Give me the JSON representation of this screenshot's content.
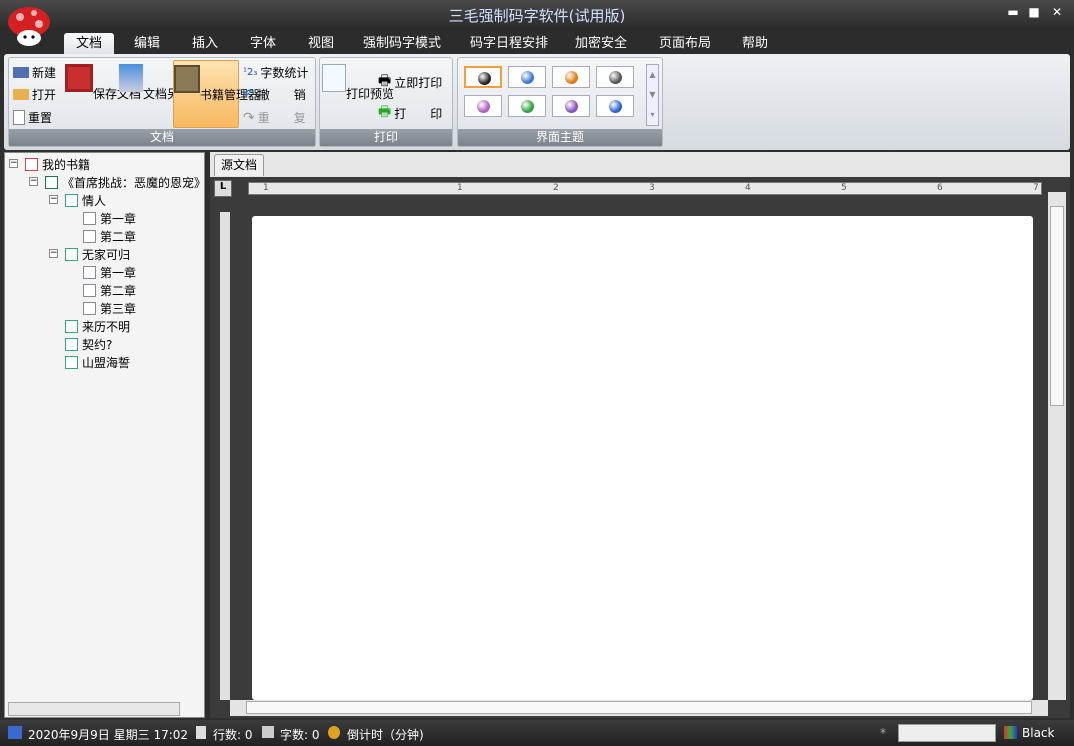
{
  "window": {
    "title": "三毛强制码字软件(试用版)",
    "minimize": "▬",
    "maximize": "■",
    "close": "✕"
  },
  "tabs": [
    "文档",
    "编辑",
    "插入",
    "字体",
    "视图",
    "强制码字模式",
    "码字日程安排",
    "加密安全",
    "页面布局",
    "帮助"
  ],
  "ribbon": {
    "doc_group": {
      "label": "文档",
      "new": "新建",
      "open": "打开",
      "reset": "重置",
      "save": "保存文档",
      "save_as": "文档另存",
      "book_manager": "书籍管理器",
      "word_count": "字数统计",
      "undo": "撤　　销",
      "redo": "重　　复"
    },
    "print_group": {
      "label": "打印",
      "preview": "打印预览",
      "print_now": "立即打印",
      "print": "打　　印"
    },
    "theme_group": {
      "label": "界面主题",
      "themes": [
        "#222222",
        "#3a78c8",
        "#e07a10",
        "#555555",
        "#b060c0",
        "#30a040",
        "#8a50c0",
        "#2a60d0"
      ]
    }
  },
  "tree": {
    "root": "我的书籍",
    "book": "《首席挑战：恶魔的恩宠》",
    "nodes": [
      {
        "label": "情人",
        "children": [
          "第一章",
          "第二章"
        ]
      },
      {
        "label": "无家可归",
        "children": [
          "第一章",
          "第二章",
          "第三章"
        ]
      },
      {
        "label": "来历不明"
      },
      {
        "label": "契约?"
      },
      {
        "label": "山盟海誓"
      }
    ]
  },
  "doc": {
    "tab": "源文档",
    "ruler_labels": [
      "1",
      "1",
      "2",
      "3",
      "4",
      "5",
      "6",
      "7"
    ]
  },
  "status": {
    "datetime": "2020年9月9日 星期三 17:02",
    "lines": "行数: 0",
    "chars": "字数: 0",
    "countdown": "倒计时（分钟)",
    "theme": "Black",
    "asterisk": "*"
  }
}
